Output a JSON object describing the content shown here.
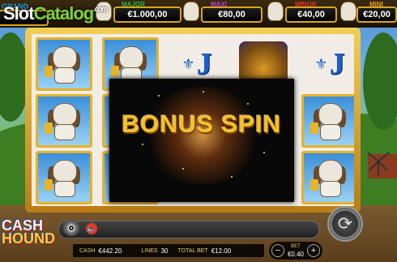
{
  "watermark": {
    "word1": "Slot",
    "word2": "Catalog",
    "suffix": ".com"
  },
  "jackpots": [
    {
      "name": "GRAND",
      "value": "",
      "color": "#1a9be6"
    },
    {
      "name": "MAJOR",
      "value": "€1.000,00",
      "color": "#2fb84a"
    },
    {
      "name": "MAXI",
      "value": "€80,00",
      "color": "#c13ad9"
    },
    {
      "name": "MINOR",
      "value": "€40,00",
      "color": "#e6322a"
    },
    {
      "name": "MINI",
      "value": "€20,00",
      "color": "#f09a1c"
    }
  ],
  "reels": [
    [
      "dog",
      "dog",
      "dog"
    ],
    [
      "dog",
      "dog",
      "dog"
    ],
    [
      "J",
      "",
      ""
    ],
    [
      "gold",
      "",
      ""
    ],
    [
      "J",
      "dog",
      "dog"
    ]
  ],
  "symbols": {
    "J": "J",
    "fleur": "⚜"
  },
  "bonus_banner": {
    "text": "BONUS SPIN"
  },
  "game_logo": {
    "line1": "CASH",
    "line2": "HOUND"
  },
  "controls": {
    "settings_icon": "gear-icon",
    "sound_icon": "speaker-icon",
    "spin_icon": "spin-arrows-icon",
    "spin_glyph": "⟳",
    "minus": "−",
    "plus": "+"
  },
  "info": {
    "cash_label": "CASH",
    "cash_value": "€442.20",
    "lines_label": "LINES",
    "lines_value": "30",
    "total_bet_label": "TOTAL BET",
    "total_bet_value": "€12.00",
    "bet_label": "BET",
    "bet_value": "€0.40"
  }
}
